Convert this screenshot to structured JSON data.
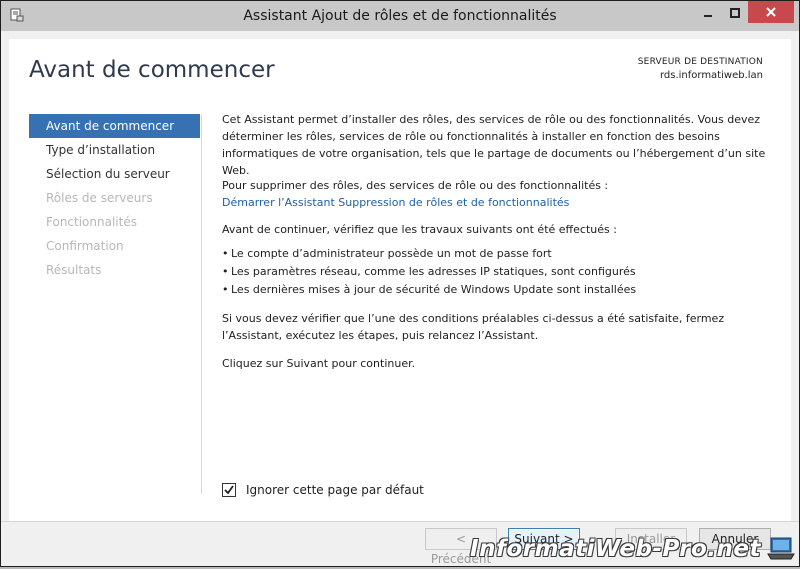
{
  "window": {
    "title": "Assistant Ajout de rôles et de fonctionnalités"
  },
  "header": {
    "page_title": "Avant de commencer",
    "dest_label": "SERVEUR DE DESTINATION",
    "dest_server": "rds.informatiweb.lan"
  },
  "nav": {
    "items": [
      {
        "label": "Avant de commencer",
        "state": "active"
      },
      {
        "label": "Type d’installation",
        "state": "normal"
      },
      {
        "label": "Sélection du serveur",
        "state": "normal"
      },
      {
        "label": "Rôles de serveurs",
        "state": "disabled"
      },
      {
        "label": "Fonctionnalités",
        "state": "disabled"
      },
      {
        "label": "Confirmation",
        "state": "disabled"
      },
      {
        "label": "Résultats",
        "state": "disabled"
      }
    ]
  },
  "content": {
    "intro": "Cet Assistant permet d’installer des rôles, des services de rôle ou des fonctionnalités. Vous devez déterminer les rôles, services de rôle ou fonctionnalités à installer en fonction des besoins informatiques de votre organisation, tels que le partage de documents ou l’hébergement d’un site Web.",
    "remove_text": "Pour supprimer des rôles, des services de rôle ou des fonctionnalités :",
    "remove_link": "Démarrer l’Assistant Suppression de rôles et de fonctionnalités",
    "verify_text": "Avant de continuer, vérifiez que les travaux suivants ont été effectués :",
    "bullets": [
      "Le compte d’administrateur possède un mot de passe fort",
      "Les paramètres réseau, comme les adresses IP statiques, sont configurés",
      "Les dernières mises à jour de sécurité de Windows Update sont installées"
    ],
    "conditions_text": "Si vous devez vérifier que l’une des conditions préalables ci-dessus a été satisfaite, fermez l’Assistant, exécutez les étapes, puis relancez l’Assistant.",
    "continue_text": "Cliquez sur Suivant pour continuer."
  },
  "skip_checkbox": {
    "label": "Ignorer cette page par défaut",
    "checked": true
  },
  "buttons": {
    "previous": "< Précédent",
    "next": "Suivant >",
    "install": "Installer",
    "cancel": "Annuler"
  },
  "watermark": {
    "text": "InformatiWeb-Pro.net"
  },
  "colors": {
    "accent": "#3672b3",
    "link": "#1f5fa8",
    "close_button": "#c7484d"
  }
}
